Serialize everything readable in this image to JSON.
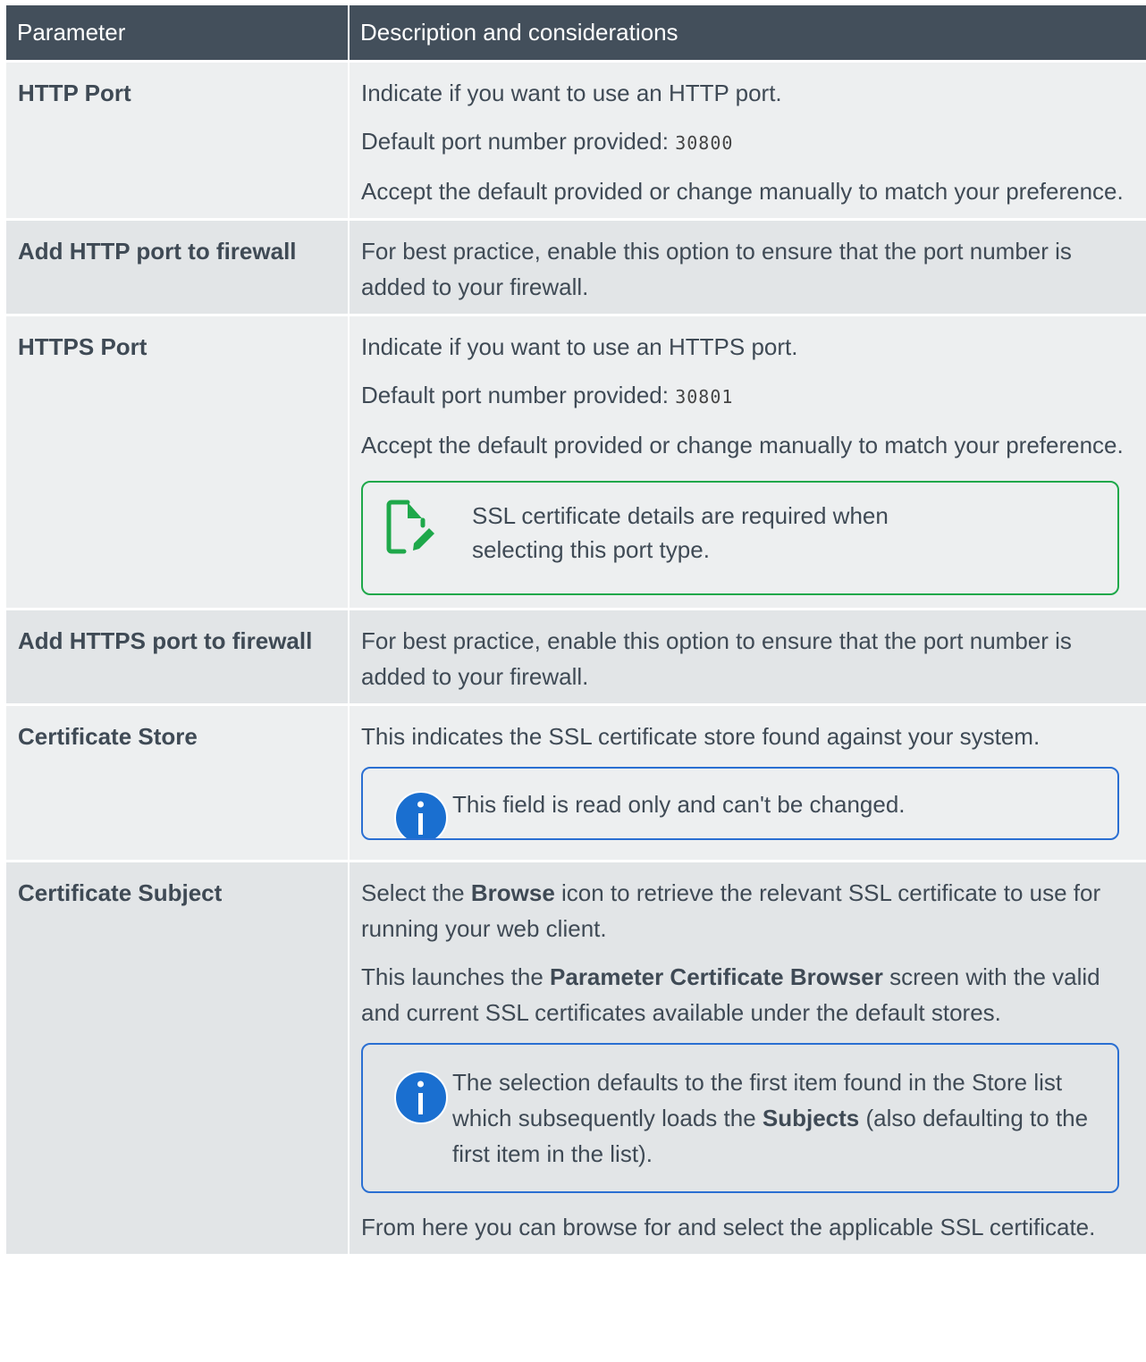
{
  "table": {
    "headers": [
      "Parameter",
      "Description and considerations"
    ],
    "rows": {
      "http_port": {
        "name": "HTTP Port",
        "p1": "Indicate if you want to use an HTTP port.",
        "p2_prefix": "Default port number provided: ",
        "p2_value": "30800",
        "p3": "Accept the default provided or change manually to match your preference."
      },
      "http_fw": {
        "name": "Add HTTP port to firewall",
        "p1": "For best practice, enable this option to ensure that the port number is added to your firewall."
      },
      "https_port": {
        "name": "HTTPS Port",
        "p1": "Indicate if you want to use an HTTPS port.",
        "p2_prefix": "Default port number provided: ",
        "p2_value": "30801",
        "p3": "Accept the default provided or change manually to match your preference.",
        "note": "SSL certificate details are required when selecting this port type."
      },
      "https_fw": {
        "name": "Add HTTPS port to firewall",
        "p1": "For best practice, enable this option to ensure that the port number is added to your firewall."
      },
      "cert_store": {
        "name": "Certificate Store",
        "p1": "This indicates the SSL certificate store found against your system.",
        "info": "This field is read only and can't be changed."
      },
      "cert_subject": {
        "name": "Certificate Subject",
        "p1_a": "Select the ",
        "p1_b": "Browse",
        "p1_c": " icon to retrieve the relevant SSL certificate to use for running your web client.",
        "p2_a": "This launches the ",
        "p2_b": "Parameter Certificate Browser",
        "p2_c": " screen with the valid and current SSL certificates available under the default stores.",
        "info_a": "The selection defaults to the first item found in the Store list which subsequently loads the ",
        "info_b": "Subjects",
        "info_c": " (also defaulting to the first item in the list).",
        "p3": "From here you can browse for and select the applicable SSL certificate."
      }
    }
  },
  "icons": {
    "note": "document-edit-icon",
    "info": "info-icon"
  },
  "colors": {
    "header_bg": "#434f5b",
    "note_border": "#1ea84a",
    "info_border": "#2a6fd2",
    "info_icon": "#1a6fd0"
  }
}
